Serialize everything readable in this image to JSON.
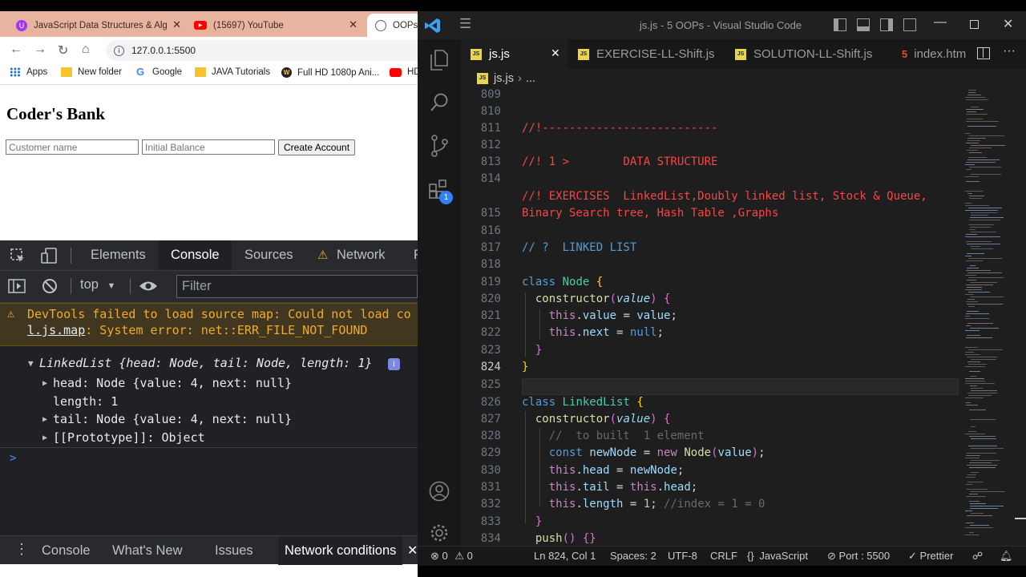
{
  "browser": {
    "tabs": [
      {
        "label": "JavaScript Data Structures & Alg",
        "icon": "udemy-icon"
      },
      {
        "label": "(15697) YouTube",
        "icon": "youtube-icon"
      },
      {
        "label": "OOPs",
        "icon": "globe-icon"
      }
    ],
    "url": "127.0.0.1:5500",
    "bookmarks": [
      {
        "label": "Apps",
        "icon": "apps-grid-icon"
      },
      {
        "label": "New folder",
        "icon": "folder-icon"
      },
      {
        "label": "Google",
        "icon": "google-icon"
      },
      {
        "label": "JAVA Tutorials",
        "icon": "folder-icon"
      },
      {
        "label": "Full HD 1080p Ani...",
        "icon": "site-icon"
      },
      {
        "label": "HD",
        "icon": "youtube-icon"
      }
    ],
    "page": {
      "heading": "Coder's Bank",
      "name_placeholder": "Customer name",
      "balance_placeholder": "Initial Balance",
      "create_button": "Create Account"
    }
  },
  "devtools": {
    "tabs": [
      "Elements",
      "Console",
      "Sources",
      "Network",
      "P"
    ],
    "context": "top",
    "filter_placeholder": "Filter",
    "warning_line1": "DevTools failed to load source map: Could not load co",
    "warning_file": "l.js.map",
    "warning_line2": ": System error: net::ERR_FILE_NOT_FOUND",
    "object": {
      "summary": "LinkedList {head: Node, tail: Node, length: 1}",
      "head": "head: Node {value: 4, next: null}",
      "length": "length: 1",
      "tail": "tail: Node {value: 4, next: null}",
      "proto": "[[Prototype]]: Object"
    },
    "prompt": ">",
    "drawer_tabs": [
      "Console",
      "What's New",
      "Issues",
      "Network conditions"
    ]
  },
  "vscode": {
    "title": "js.js - 5 OOPs - Visual Studio Code",
    "tabs": [
      {
        "label": "js.js",
        "active": true
      },
      {
        "label": "EXERCISE-LL-Shift.js",
        "active": false
      },
      {
        "label": "SOLUTION-LL-Shift.js",
        "active": false
      },
      {
        "label": "index.htm",
        "active": false
      }
    ],
    "breadcrumb": [
      "js.js",
      "..."
    ],
    "extensions_badge": "1",
    "line_numbers": [
      "809",
      "810",
      "811",
      "812",
      "813",
      "814",
      "",
      "815",
      "816",
      "817",
      "818",
      "819",
      "820",
      "821",
      "822",
      "823",
      "824",
      "825",
      "826",
      "827",
      "828",
      "829",
      "830",
      "831",
      "832",
      "833",
      "834"
    ],
    "code": {
      "l810": "//!--------------------------",
      "l812": "//! 1 >        DATA STRUCTURE",
      "l814a": "//! EXERCISES  LinkedList,Doubly linked list, Stock & Queue,",
      "l814b": "Binary Search tree, Hash Table ,Graphs",
      "l816": "// ?  LINKED LIST",
      "l827": "//  to built  1 element",
      "l831c": "//index = 1 = 0"
    },
    "status": {
      "errors": "0",
      "warnings": "0",
      "position": "Ln 824, Col 1",
      "spaces": "Spaces: 2",
      "encoding": "UTF-8",
      "eol": "CRLF",
      "language": "JavaScript",
      "port": "Port : 5500",
      "prettier": "Prettier"
    }
  },
  "colors": {
    "browser_tabstrip": "#e8b4a0",
    "devtools_bg": "#202124",
    "warning_text": "#f2ab26",
    "vscode_bg": "#1e1e1e",
    "comment_red": "#f44747",
    "comment_blue": "#569cd6"
  }
}
